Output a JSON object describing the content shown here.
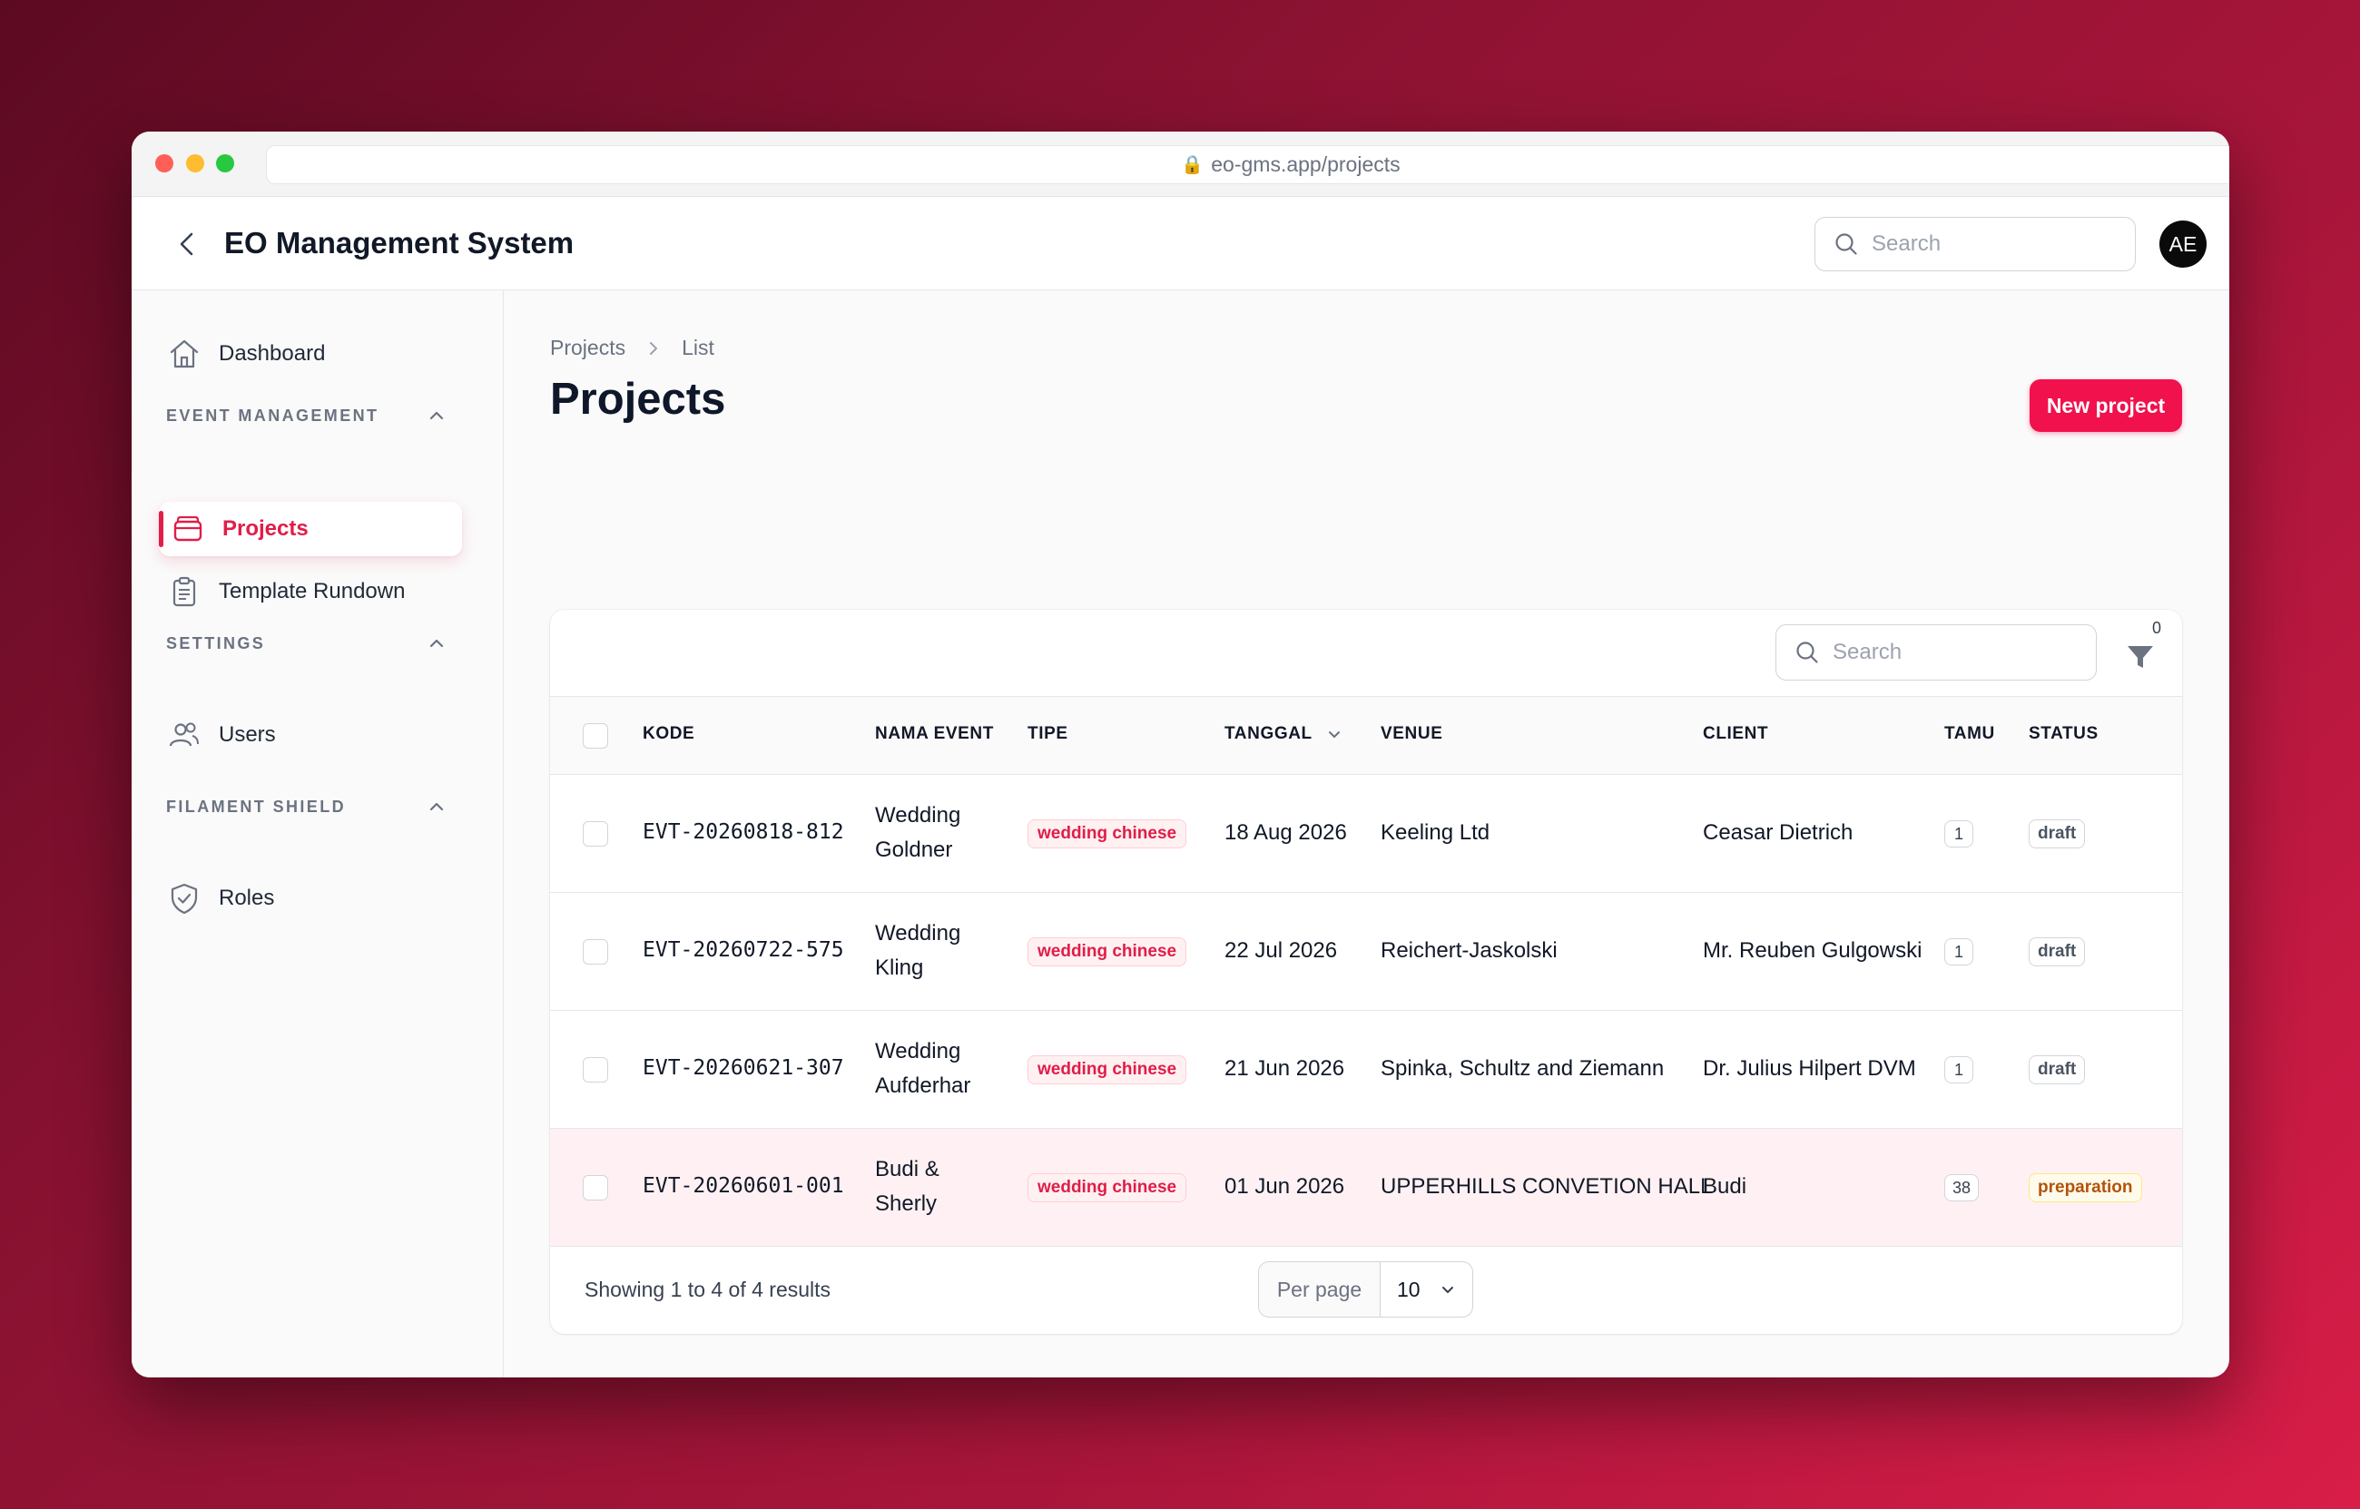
{
  "browser": {
    "url": "eo-gms.app/projects"
  },
  "topbar": {
    "title": "EO Management System",
    "search_placeholder": "Search",
    "avatar_initials": "AE"
  },
  "sidebar": {
    "dashboard": "Dashboard",
    "groups": [
      {
        "label": "EVENT MANAGEMENT",
        "items": [
          {
            "label": "Projects",
            "icon": "folder-icon",
            "active": true
          },
          {
            "label": "Template Rundown",
            "icon": "clipboard-icon"
          }
        ]
      },
      {
        "label": "SETTINGS",
        "items": [
          {
            "label": "Users",
            "icon": "users-icon"
          }
        ]
      },
      {
        "label": "FILAMENT SHIELD",
        "items": [
          {
            "label": "Roles",
            "icon": "shield-check-icon"
          }
        ]
      }
    ]
  },
  "breadcrumb": {
    "root": "Projects",
    "current": "List"
  },
  "page": {
    "title": "Projects",
    "new_button": "New project"
  },
  "table": {
    "search_placeholder": "Search",
    "filter_count": "0",
    "columns": {
      "kode": "KODE",
      "nama_event": "NAMA EVENT",
      "tipe": "TIPE",
      "tanggal": "TANGGAL",
      "venue": "VENUE",
      "client": "CLIENT",
      "tamu": "TAMU",
      "status": "STATUS"
    },
    "rows": [
      {
        "kode": "EVT-20260818-812",
        "nama1": "Wedding",
        "nama2": "Goldner",
        "tipe": "wedding chinese",
        "tanggal": "18 Aug 2026",
        "venue": "Keeling Ltd",
        "client": "Ceasar Dietrich",
        "tamu": "1",
        "status": "draft"
      },
      {
        "kode": "EVT-20260722-575",
        "nama1": "Wedding",
        "nama2": "Kling",
        "tipe": "wedding chinese",
        "tanggal": "22 Jul 2026",
        "venue": "Reichert-Jaskolski",
        "client": "Mr. Reuben Gulgowski",
        "tamu": "1",
        "status": "draft"
      },
      {
        "kode": "EVT-20260621-307",
        "nama1": "Wedding",
        "nama2": "Aufderhar",
        "tipe": "wedding chinese",
        "tanggal": "21 Jun 2026",
        "venue": "Spinka, Schultz and Ziemann",
        "client": "Dr. Julius Hilpert DVM",
        "tamu": "1",
        "status": "draft"
      },
      {
        "kode": "EVT-20260601-001",
        "nama1": "Budi &",
        "nama2": "Sherly",
        "tipe": "wedding chinese",
        "tanggal": "01 Jun 2026",
        "venue": "UPPERHILLS CONVETION HALL",
        "client": "Budi",
        "tamu": "38",
        "status": "preparation"
      }
    ],
    "footer": {
      "summary": "Showing 1 to 4 of 4 results",
      "per_page_label": "Per page",
      "per_page_value": "10"
    }
  },
  "colors": {
    "accent": "#e11d48",
    "button": "#f0114d"
  }
}
